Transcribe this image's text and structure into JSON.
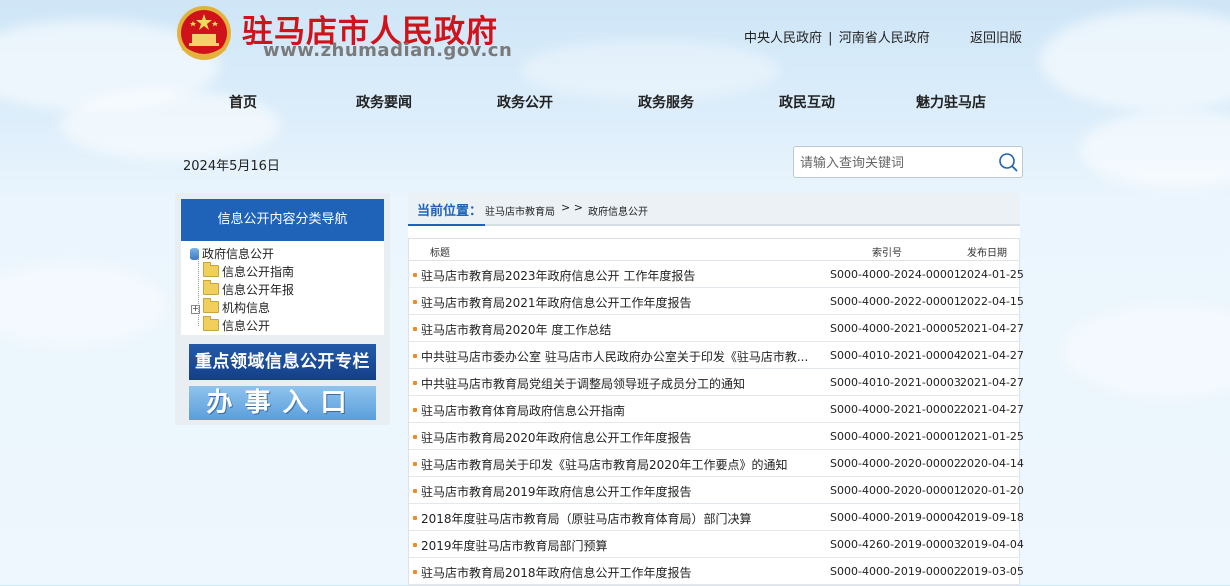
{
  "header": {
    "site_name": "驻马店市人民政府",
    "site_url": "www.zhumadian.gov.cn",
    "link_central": "中央人民政府",
    "link_sep": "|",
    "link_henan": "河南省人民政府",
    "back_old": "返回旧版"
  },
  "nav": {
    "items": [
      {
        "label": "首页"
      },
      {
        "label": "政务要闻"
      },
      {
        "label": "政务公开"
      },
      {
        "label": "政务服务"
      },
      {
        "label": "政民互动"
      },
      {
        "label": "魅力驻马店"
      }
    ]
  },
  "date": "2024年5月16日",
  "search": {
    "placeholder": "请输入查询关键词",
    "icon": "search-icon"
  },
  "sidebar": {
    "title": "信息公开内容分类导航",
    "root": "政府信息公开",
    "items": [
      {
        "label": "信息公开指南"
      },
      {
        "label": "信息公开年报"
      },
      {
        "label": "机构信息"
      },
      {
        "label": "信息公开"
      }
    ],
    "expand_symbol": "+",
    "banner_special": "重点领域信息公开专栏",
    "banner_service": "办事入口"
  },
  "breadcrumb": {
    "label": "当前位置：",
    "dept": "驻马店市教育局",
    "sep": "> >",
    "page": "政府信息公开"
  },
  "table": {
    "headers": {
      "title": "标题",
      "index": "索引号",
      "date": "发布日期"
    },
    "rows": [
      {
        "title": "驻马店市教育局2023年政府信息公开 工作年度报告",
        "index": "S000-4000-2024-00001",
        "date": "2024-01-25"
      },
      {
        "title": "驻马店市教育局2021年政府信息公开工作年度报告",
        "index": "S000-4000-2022-00001",
        "date": "2022-04-15"
      },
      {
        "title": "驻马店市教育局2020年 度工作总结",
        "index": "S000-4000-2021-00005",
        "date": "2021-04-27"
      },
      {
        "title": "中共驻马店市委办公室 驻马店市人民政府办公室关于印发《驻马店市教...",
        "index": "S000-4010-2021-00004",
        "date": "2021-04-27"
      },
      {
        "title": "中共驻马店市教育局党组关于调整局领导班子成员分工的通知",
        "index": "S000-4010-2021-00003",
        "date": "2021-04-27"
      },
      {
        "title": "驻马店市教育体育局政府信息公开指南",
        "index": "S000-4000-2021-00002",
        "date": "2021-04-27"
      },
      {
        "title": "驻马店市教育局2020年政府信息公开工作年度报告",
        "index": "S000-4000-2021-00001",
        "date": "2021-01-25"
      },
      {
        "title": "驻马店市教育局关于印发《驻马店市教育局2020年工作要点》的通知",
        "index": "S000-4000-2020-00002",
        "date": "2020-04-14"
      },
      {
        "title": "驻马店市教育局2019年政府信息公开工作年度报告",
        "index": "S000-4000-2020-00001",
        "date": "2020-01-20"
      },
      {
        "title": "2018年度驻马店市教育局（原驻马店市教育体育局）部门决算",
        "index": "S000-4000-2019-00004",
        "date": "2019-09-18"
      },
      {
        "title": "2019年度驻马店市教育局部门预算",
        "index": "S000-4260-2019-00003",
        "date": "2019-04-04"
      },
      {
        "title": "驻马店市教育局2018年政府信息公开工作年度报告",
        "index": "S000-4000-2019-00002",
        "date": "2019-03-05"
      }
    ]
  },
  "colors": {
    "brand_red": "#d0121b",
    "nav_blue": "#1e63b7",
    "bullet_orange": "#f08a24"
  }
}
